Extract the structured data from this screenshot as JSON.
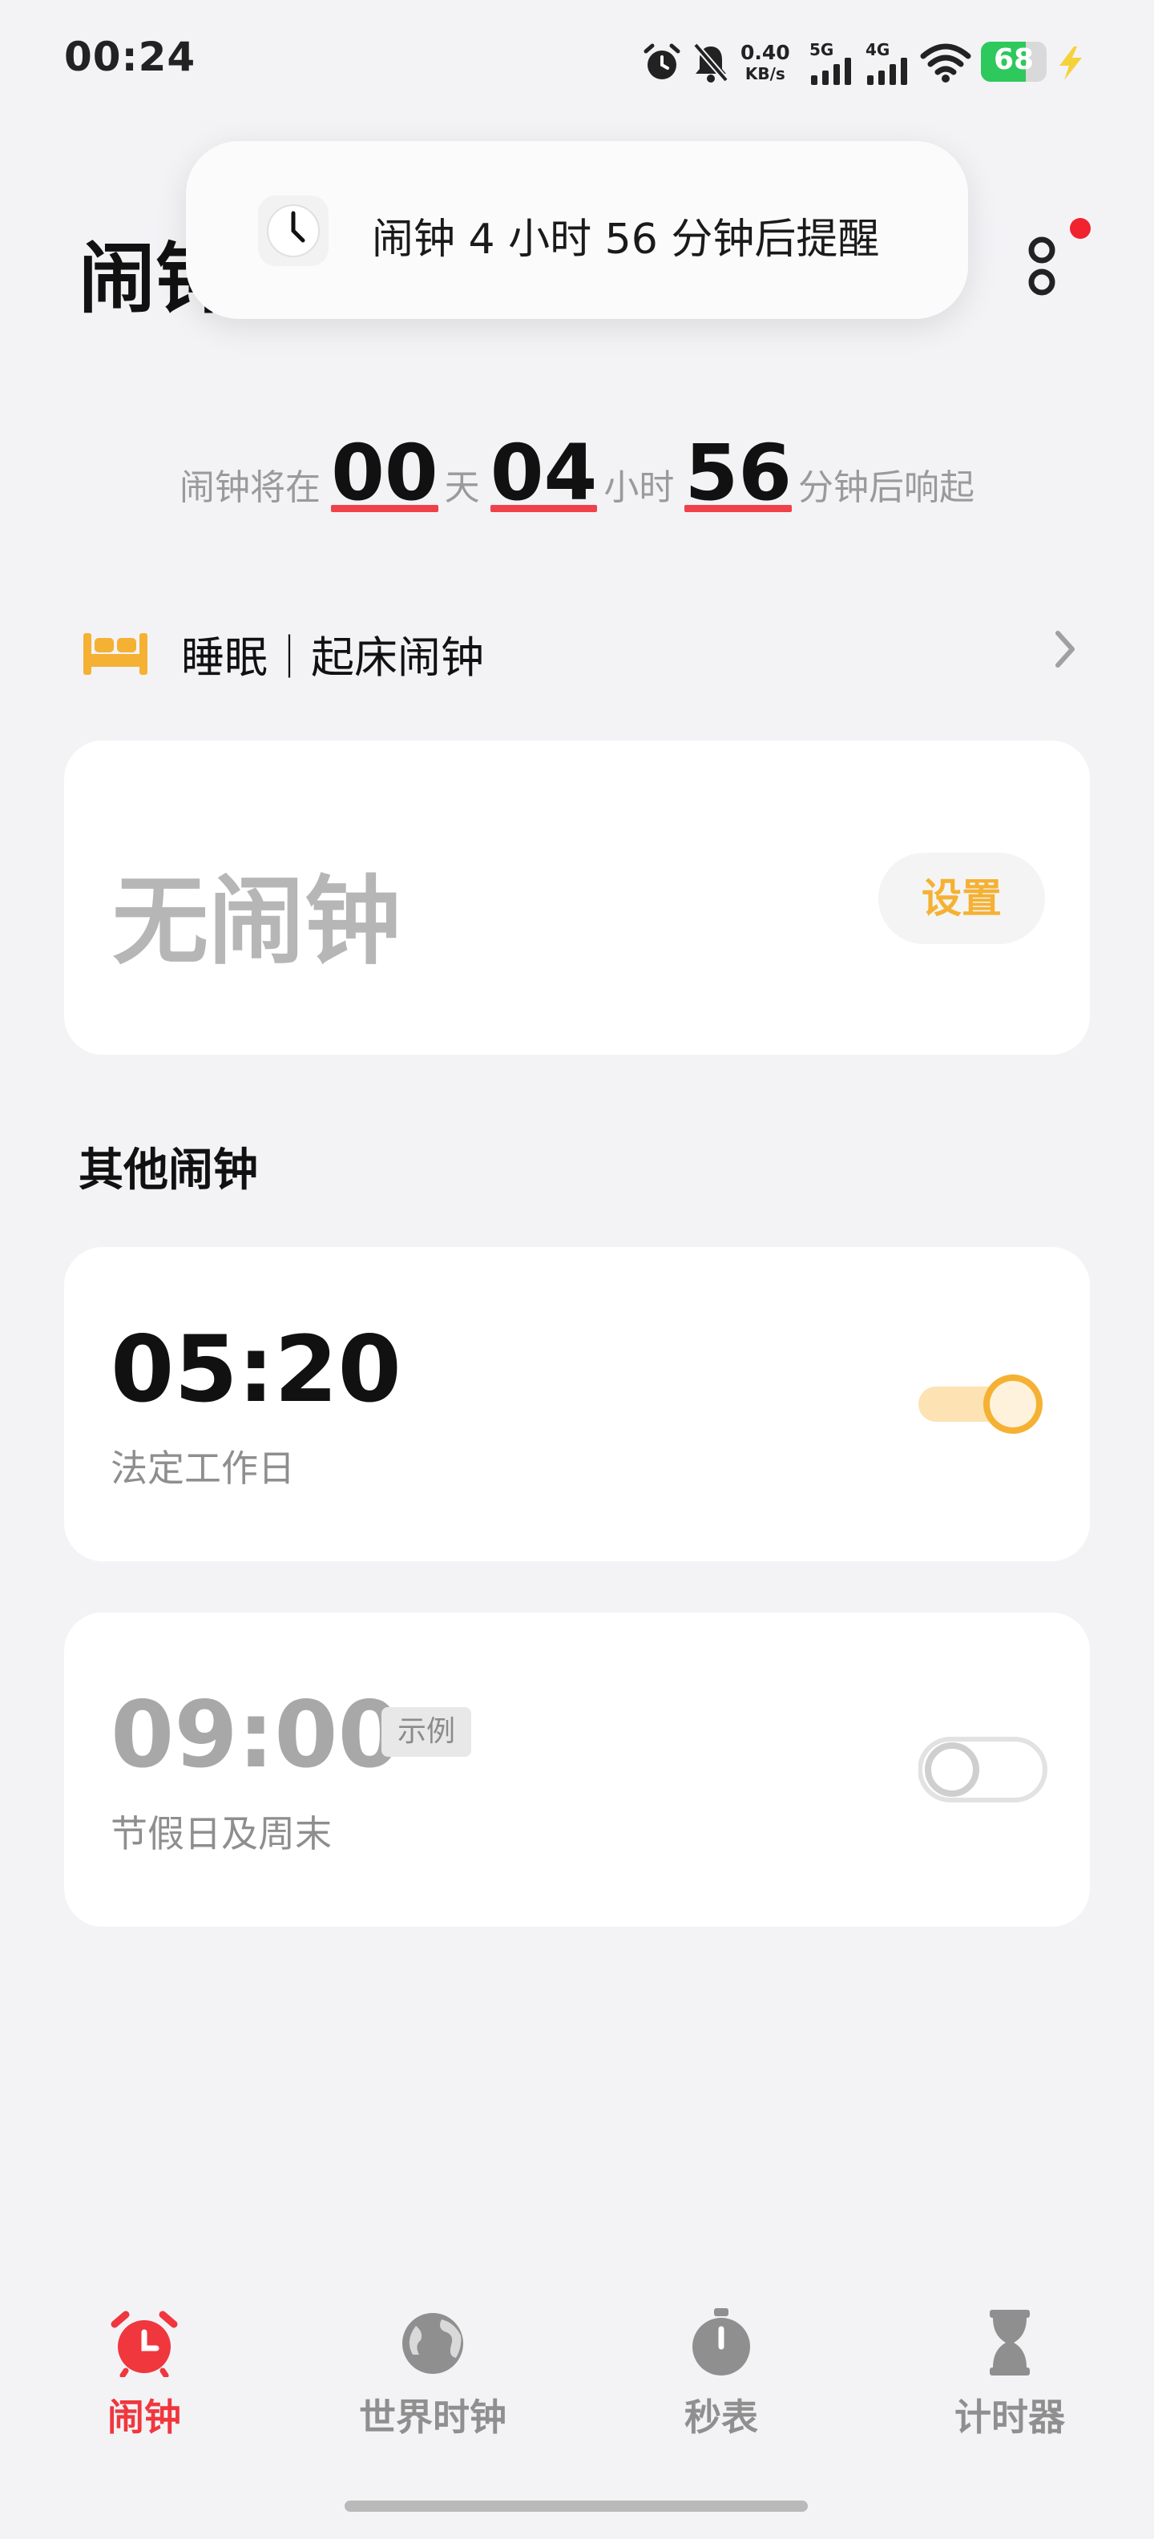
{
  "status_bar": {
    "time": "00:24",
    "speed_value": "0.40",
    "speed_unit": "KB/s",
    "net1": "5G",
    "net2": "4G",
    "battery": "68",
    "battery_color": "#2ec95c",
    "charge_color": "#f5d23a"
  },
  "header": {
    "title": "闹钟"
  },
  "toast": {
    "text": "闹钟 4 小时 56 分钟后提醒"
  },
  "countdown": {
    "prefix": "闹钟将在",
    "days": "00",
    "days_unit": "天",
    "hours": "04",
    "hours_unit": "小时",
    "minutes": "56",
    "suffix": "分钟后响起",
    "underline_color": "#f0414a"
  },
  "sleep": {
    "label": "睡眠｜起床闹钟",
    "icon_color": "#f5b133"
  },
  "main_alarm": {
    "empty_text": "无闹钟",
    "set_button": "设置"
  },
  "others": {
    "title": "其他闹钟",
    "alarms": [
      {
        "time": "05:20",
        "repeat": "法定工作日",
        "enabled": true
      },
      {
        "time": "09:00",
        "tag": "示例",
        "repeat": "节假日及周末",
        "enabled": false
      }
    ]
  },
  "nav": {
    "items": [
      {
        "label": "闹钟",
        "icon": "alarm-clock-icon",
        "active": true
      },
      {
        "label": "世界时钟",
        "icon": "globe-icon",
        "active": false
      },
      {
        "label": "秒表",
        "icon": "stopwatch-icon",
        "active": false
      },
      {
        "label": "计时器",
        "icon": "hourglass-icon",
        "active": false
      }
    ],
    "active_color": "#f0373d"
  }
}
